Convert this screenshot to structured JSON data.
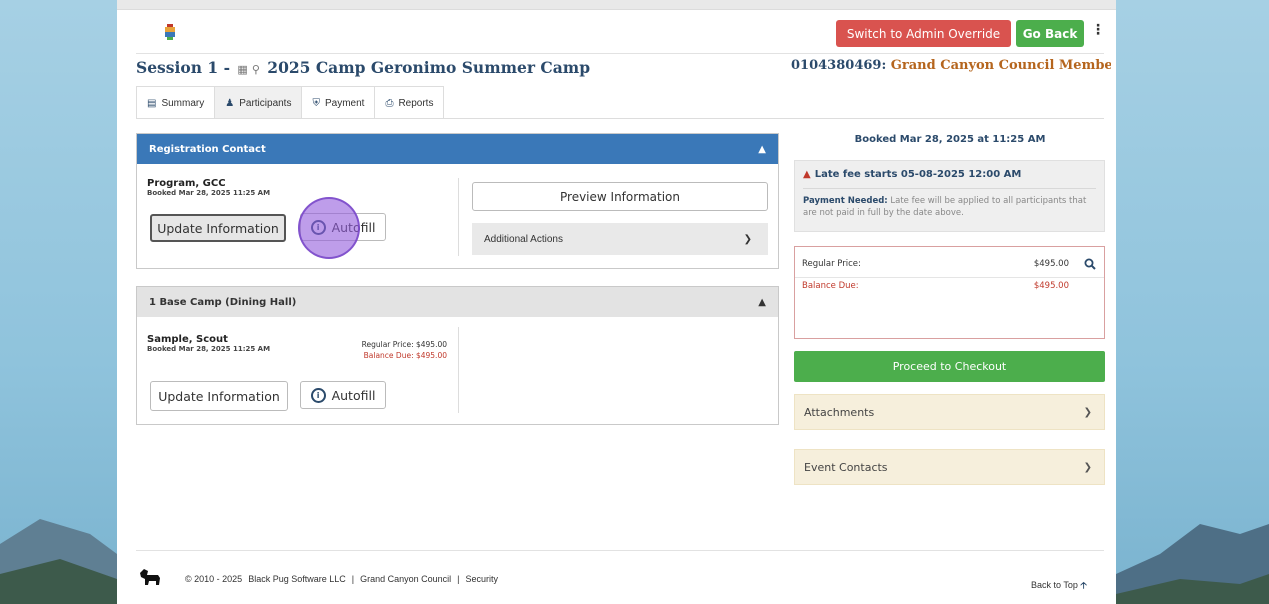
{
  "header": {
    "admin_override_label": "Switch to Admin Override",
    "go_back_label": "Go Back",
    "more_icon": "kebab-icon"
  },
  "session": {
    "prefix": "Session 1 -",
    "calendar_icon": "calendar-icon",
    "pin_icon": "map-pin-icon",
    "title": "2025 Camp Geronimo Summer Camp",
    "account_number": "0104380469:",
    "council_name": "Grand Canyon Council Member of"
  },
  "tabs": [
    {
      "label": "Summary",
      "icon": "summary-icon"
    },
    {
      "label": "Participants",
      "icon": "person-icon"
    },
    {
      "label": "Payment",
      "icon": "cart-icon"
    },
    {
      "label": "Reports",
      "icon": "printer-icon"
    }
  ],
  "registration_contact": {
    "heading": "Registration Contact",
    "name": "Program, GCC",
    "booked": "Booked Mar 28, 2025 11:25 AM",
    "update_label": "Update Information",
    "autofill_label": "Autofill",
    "preview_label": "Preview Information",
    "additional_actions_label": "Additional Actions"
  },
  "base_camp": {
    "heading": "1 Base Camp (Dining Hall)",
    "name": "Sample, Scout",
    "booked": "Booked Mar 28, 2025 11:25 AM",
    "regular_price_line": "Regular Price: $495.00",
    "balance_due_line": "Balance Due: $495.00",
    "update_label": "Update Information",
    "autofill_label": "Autofill"
  },
  "sidebar": {
    "booked_at": "Booked Mar 28, 2025 at 11:25 AM",
    "late_fee_title": "Late fee starts 05-08-2025 12:00 AM",
    "payment_needed_label": "Payment Needed:",
    "payment_needed_text": "Late fee will be applied to all participants that are not paid in full by the date above.",
    "regular_price_label": "Regular Price:",
    "regular_price_value": "$495.00",
    "balance_due_label": "Balance Due:",
    "balance_due_value": "$495.00",
    "checkout_label": "Proceed to Checkout",
    "attachments_label": "Attachments",
    "event_contacts_label": "Event Contacts"
  },
  "footer": {
    "copyright": "© 2010 - 2025",
    "company": "Black Pug Software LLC",
    "sep1": "|",
    "council": "Grand Canyon Council",
    "sep2": "|",
    "security": "Security",
    "back_to_top": "Back to Top"
  },
  "colors": {
    "admin_button": "#d9534f",
    "go_back_button": "#4cae4c",
    "registration_header": "#3a78b8",
    "checkout_button": "#4cae4c",
    "council_name": "#b5651d",
    "balance_due": "#c0392b"
  }
}
